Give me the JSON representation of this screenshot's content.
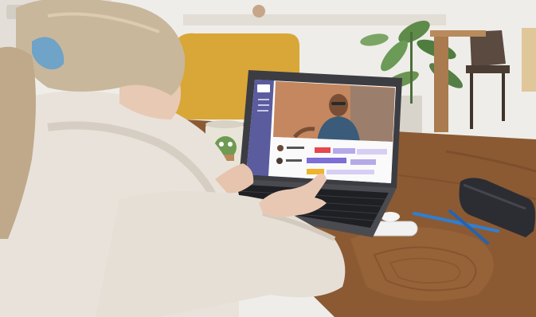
{
  "scene": {
    "colors": {
      "wall": "#efede9",
      "shelf": "#e6e2dc",
      "sofa": "#d9a737",
      "table_wood": "#8b5a33",
      "table_wood_light": "#b27a4c",
      "sweater": "#e8e2da",
      "hair": "#c9b79b",
      "hair_clip": "#6fa3c8",
      "laptop_body": "#3c3d42",
      "laptop_sidebar": "#5b5c9e",
      "mug": "#e9e4d8",
      "mug_character": "#6f9a53",
      "pencil_blue": "#2f7fd1",
      "pencil_case": "#2c2d33",
      "usb_stick": "#f1f1f1"
    },
    "screen": {
      "gantt_bar_colors": [
        "#e5484d",
        "#f0b429",
        "#7c6fd6",
        "#b6a9e8",
        "#d7cff3"
      ]
    }
  }
}
